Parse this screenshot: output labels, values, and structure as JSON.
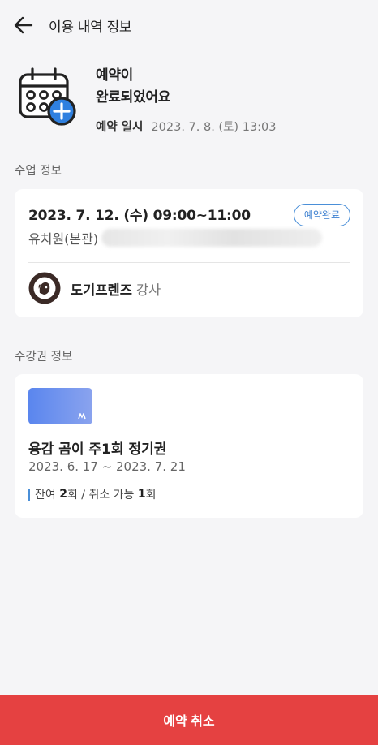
{
  "header": {
    "title": "이용 내역 정보"
  },
  "status": {
    "title_line1": "예약이",
    "title_line2": "완료되었어요",
    "date_label": "예약 일시",
    "date_value": "2023. 7. 8. (토) 13:03"
  },
  "class_info": {
    "section_label": "수업 정보",
    "datetime": "2023. 7. 12. (수) 09:00~11:00",
    "place": "유치원(본관)",
    "badge": "예약완료",
    "instructor_name": "도기프렌즈",
    "instructor_role": "강사"
  },
  "pass_info": {
    "section_label": "수강권 정보",
    "name": "용감 곰이 주1회 정기권",
    "period": "2023. 6. 17 ~ 2023. 7. 21",
    "remain_prefix": "잔여",
    "remain_count": "2",
    "remain_unit": "회 / 취소 가능",
    "cancel_count": "1",
    "cancel_unit": "회"
  },
  "footer": {
    "cancel_label": "예약 취소"
  },
  "colors": {
    "accent_blue": "#4a8fd8",
    "danger_red": "#e54141",
    "background": "#f5f5f7"
  }
}
